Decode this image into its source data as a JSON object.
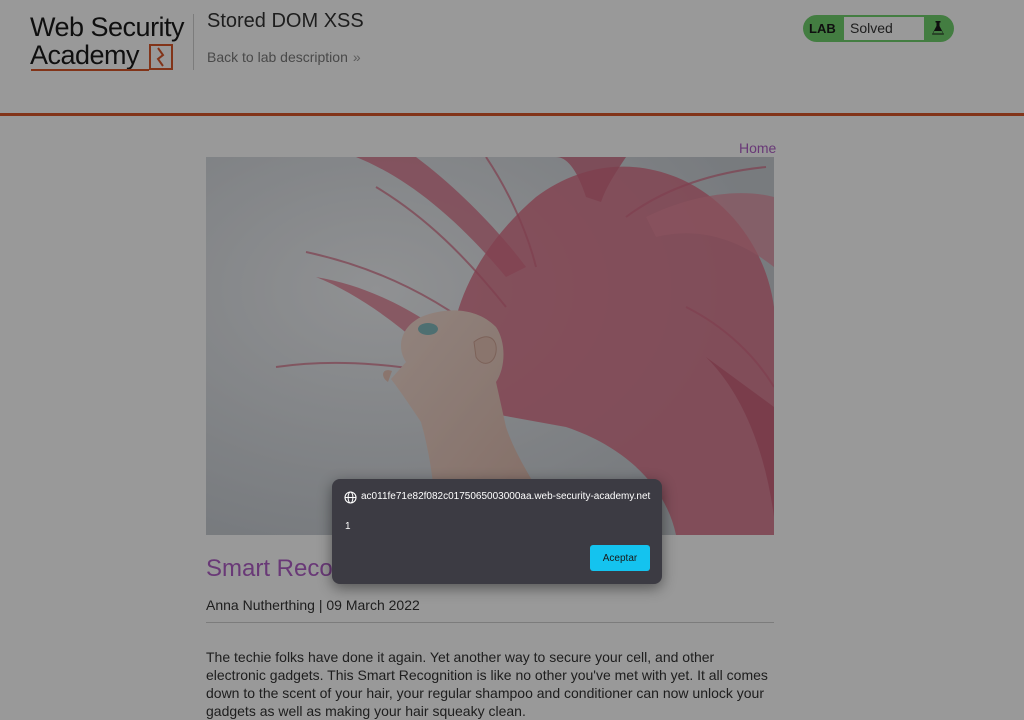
{
  "header": {
    "logo_line1": "Web Security",
    "logo_line2": "Academy",
    "lab_title": "Stored DOM XSS",
    "back_link": "Back to lab description",
    "back_chevron": "»",
    "status": {
      "lab_label": "LAB",
      "status_text": "Solved",
      "icon": "lab-flask-icon",
      "color": "#70d16d"
    },
    "accent_color": "#d9582b"
  },
  "nav": {
    "home_link": "Home"
  },
  "post": {
    "image": "woman-with-pink-hair-photo",
    "title": "Smart Recognition",
    "meta": "Anna Nutherthing | 09 March 2022",
    "body": "The techie folks have done it again. Yet another way to secure your cell, and other electronic gadgets. This Smart Recognition is like no other you've met with yet. It all comes down to the scent of your hair, your regular shampoo and conditioner can now unlock your gadgets as well as making your hair squeaky clean.",
    "title_color": "#b05fc7"
  },
  "alert": {
    "icon": "globe-icon",
    "origin": "ac011fe71e82f082c0175065003000aa.web-security-academy.net",
    "message": "1",
    "ok_label": "Aceptar",
    "button_color": "#14c3ef"
  }
}
